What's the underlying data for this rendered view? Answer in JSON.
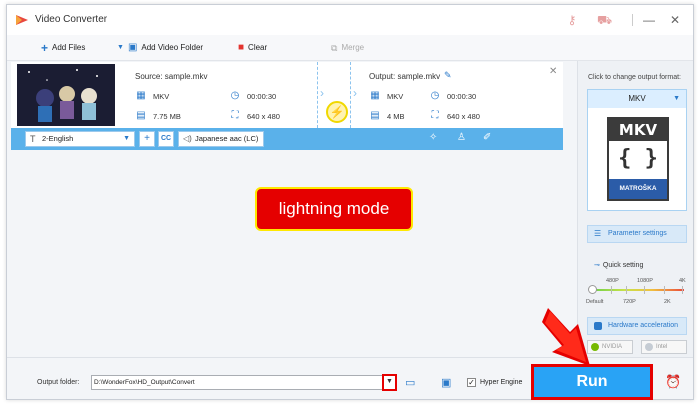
{
  "app": {
    "title": "Video Converter"
  },
  "toolbar": {
    "add_files": "Add Files",
    "add_video_folder": "Add Video Folder",
    "clear": "Clear",
    "merge": "Merge"
  },
  "file": {
    "source_label": "Source: sample.mkv",
    "output_label": "Output: sample.mkv",
    "source": {
      "format": "MKV",
      "duration": "00:00:30",
      "size": "7.75 MB",
      "resolution": "640 x 480"
    },
    "output": {
      "format": "MKV",
      "duration": "00:00:30",
      "size": "4 MB",
      "resolution": "640 x 480"
    }
  },
  "tracks": {
    "subtitle": "2-English",
    "audio": "Japanese aac (LC)"
  },
  "callout": {
    "text": "lightning mode"
  },
  "right_panel": {
    "hint": "Click to change output format:",
    "format": "MKV",
    "card_title": "MKV",
    "card_brand": "MATROŠKA",
    "parameter_settings": "Parameter settings",
    "quick_setting": "Quick setting",
    "quality_top": [
      "480P",
      "1080P",
      "4K"
    ],
    "quality_bottom": [
      "Default",
      "720P",
      "2K"
    ],
    "hardware_acceleration": "Hardware acceleration",
    "nvidia": "NVIDIA",
    "intel": "Intel"
  },
  "bottom": {
    "output_folder_label": "Output folder:",
    "output_folder_path": "D:\\WonderFox\\HD_Output\\Convert",
    "hyper_engine": "Hyper Engine",
    "run": "Run"
  }
}
